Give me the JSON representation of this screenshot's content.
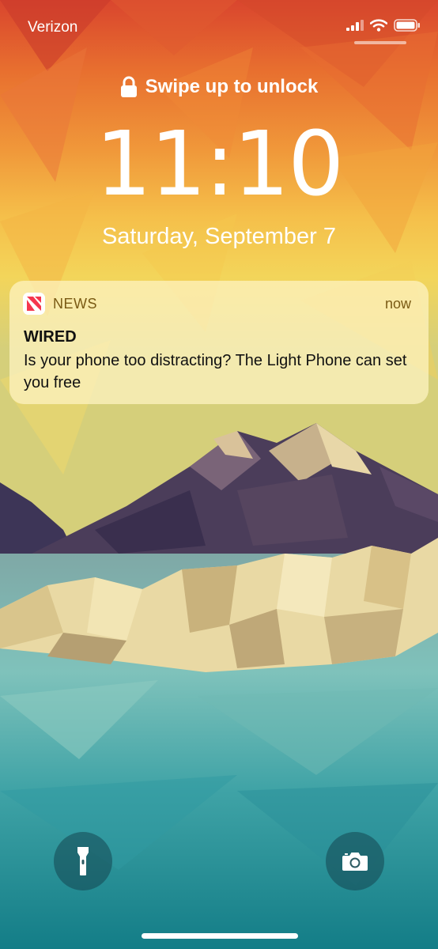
{
  "status_bar": {
    "carrier": "Verizon",
    "signal_icon": "signal-bars-icon",
    "wifi_icon": "wifi-icon",
    "battery_icon": "battery-icon"
  },
  "lock_screen": {
    "unlock_hint": "Swipe up to unlock",
    "lock_icon": "lock-icon",
    "time": "11:10",
    "date": "Saturday, September 7"
  },
  "notification": {
    "app_icon": "news-app-icon",
    "app_name": "NEWS",
    "time": "now",
    "title": "WIRED",
    "body": "Is your phone too distracting? The Light Phone can set you free"
  },
  "quick_actions": {
    "flashlight_icon": "flashlight-icon",
    "camera_icon": "camera-icon"
  },
  "colors": {
    "notification_bg": "#fff4c4",
    "news_icon_red": "#f5364d",
    "button_bg": "#144650"
  }
}
